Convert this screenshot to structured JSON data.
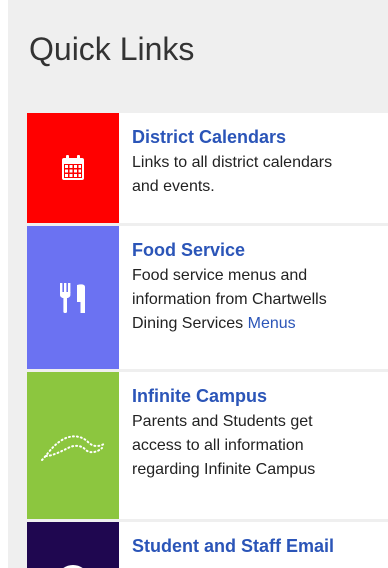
{
  "header": {
    "title": "Quick Links"
  },
  "links": [
    {
      "title": "District Calendars",
      "description": "Links to all district calendars\nand events.",
      "tile_color": "#ff0000",
      "icon": "calendar-icon"
    },
    {
      "title": "Food Service",
      "description": "Food service menus and\ninformation from Chartwells\nDining Services",
      "link_label": "Menus",
      "tile_color": "#6b72f2",
      "icon": "fork-knife-icon"
    },
    {
      "title": "Infinite Campus",
      "description": "Parents and Students get\naccess to all information\nregarding Infinite Campus",
      "tile_color": "#8cc63f",
      "icon": "infinite-campus-logo-icon"
    },
    {
      "title": "Student and Staff Email",
      "description": "",
      "tile_color": "#1f0750",
      "icon": "email-icon"
    }
  ]
}
